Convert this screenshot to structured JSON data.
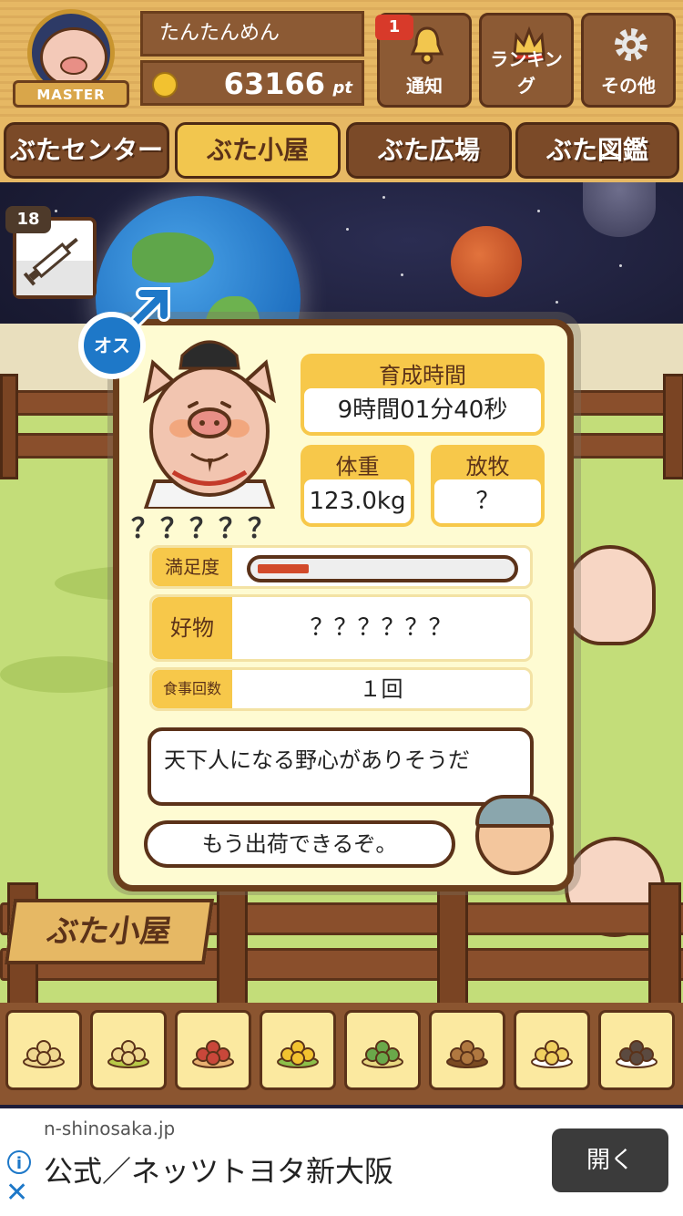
{
  "header": {
    "badge_label": "MASTER",
    "player_name": "たんたんめん",
    "points_value": "63166",
    "points_unit": "pt",
    "notification_count": "1",
    "buttons": [
      {
        "label": "通知",
        "icon": "bell-icon"
      },
      {
        "label": "ランキング",
        "icon": "crown-icon"
      },
      {
        "label": "その他",
        "icon": "gear-icon"
      }
    ]
  },
  "nav": {
    "tabs": [
      {
        "label": "ぶたセンター",
        "active": false
      },
      {
        "label": "ぶた小屋",
        "active": true
      },
      {
        "label": "ぶた広場",
        "active": false
      },
      {
        "label": "ぶた図鑑",
        "active": false
      }
    ]
  },
  "item": {
    "count": "18",
    "icon": "syringe-icon"
  },
  "pig_card": {
    "gender_label": "オス",
    "name": "？？？？？",
    "growth_time_label": "育成時間",
    "growth_time_value": "9時間01分40秒",
    "weight_label": "体重",
    "weight_value": "123.0kg",
    "grazing_label": "放牧",
    "grazing_value": "？",
    "satisfaction_label": "満足度",
    "satisfaction_level": 0.2,
    "favorite_label": "好物",
    "favorite_value": "？？？？？？",
    "meals_label": "食事回数",
    "meals_value": "１回",
    "comment": "天下人になる野心がありそうだ",
    "farmer_message": "もう出荷できるぞ。"
  },
  "sign_label": "ぶた小屋",
  "food_tray": [
    {
      "icon": "beans-icon"
    },
    {
      "icon": "mixed-beans-icon"
    },
    {
      "icon": "sweet-potato-icon"
    },
    {
      "icon": "corn-icon"
    },
    {
      "icon": "herb-berries-icon"
    },
    {
      "icon": "acorn-icon"
    },
    {
      "icon": "soybean-plate-icon"
    },
    {
      "icon": "dark-beans-plate-icon"
    }
  ],
  "ad": {
    "domain": "n-shinosaka.jp",
    "title": "公式／ネッツトヨタ新大阪",
    "open_button": "開く"
  },
  "colors": {
    "wood": "#8c5a34",
    "panel": "#fefbd2",
    "accent_yellow": "#f7c84a",
    "male_blue": "#1e78c8"
  }
}
